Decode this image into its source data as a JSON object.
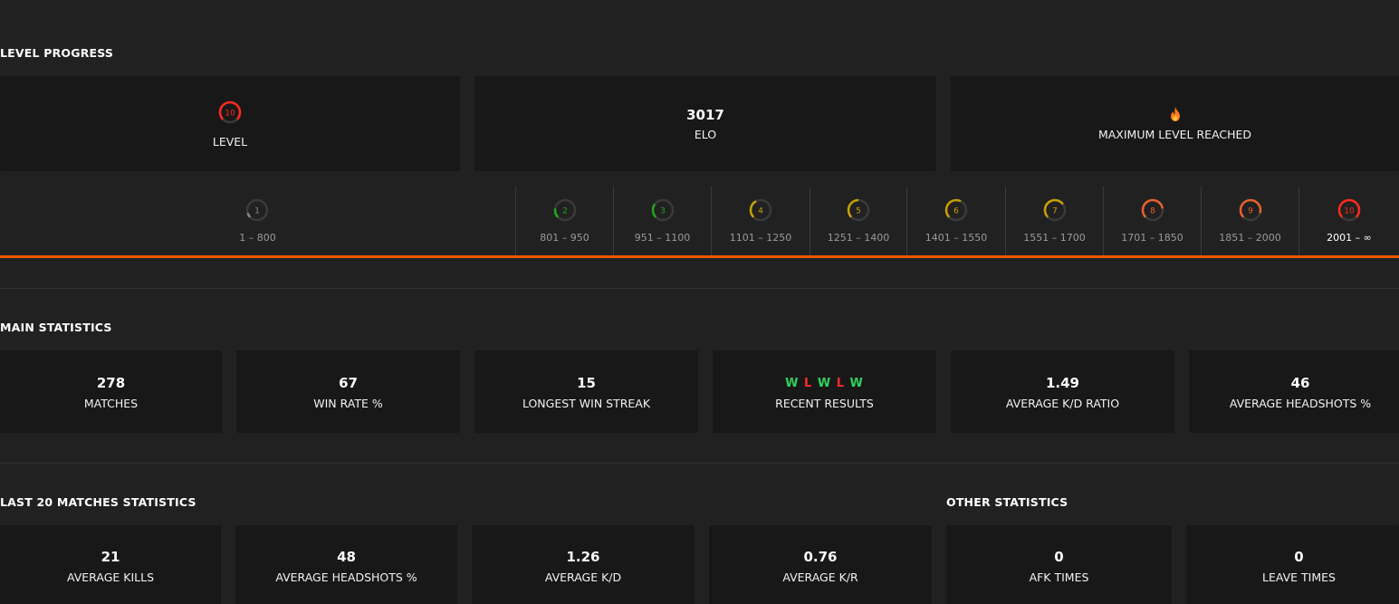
{
  "level_progress": {
    "title": "LEVEL PROGRESS",
    "level_card": {
      "level": "10",
      "label": "LEVEL"
    },
    "elo_card": {
      "value": "3017",
      "label": "ELO"
    },
    "max_card": {
      "icon": "fire-icon",
      "label": "MAXIMUM LEVEL REACHED"
    },
    "scale": [
      {
        "level": "1",
        "range": "1 – 800",
        "color": "#8a8a8a",
        "fill": 0.1
      },
      {
        "level": "2",
        "range": "801 – 950",
        "color": "#1ea81e",
        "fill": 0.2
      },
      {
        "level": "3",
        "range": "951 – 1100",
        "color": "#1ea81e",
        "fill": 0.3
      },
      {
        "level": "4",
        "range": "1101 – 1250",
        "color": "#c8a000",
        "fill": 0.4
      },
      {
        "level": "5",
        "range": "1251 – 1400",
        "color": "#c8a000",
        "fill": 0.5
      },
      {
        "level": "6",
        "range": "1401 – 1550",
        "color": "#c8a000",
        "fill": 0.6
      },
      {
        "level": "7",
        "range": "1551 – 1700",
        "color": "#c8a000",
        "fill": 0.7
      },
      {
        "level": "8",
        "range": "1701 – 1850",
        "color": "#e8612c",
        "fill": 0.8
      },
      {
        "level": "9",
        "range": "1851 – 2000",
        "color": "#e8612c",
        "fill": 0.9
      },
      {
        "level": "10",
        "range": "2001 – ∞",
        "color": "#ff2a1a",
        "fill": 1.0
      }
    ],
    "accent": "#ff5500"
  },
  "main_statistics": {
    "title": "MAIN STATISTICS",
    "cards": [
      {
        "value": "278",
        "label": "MATCHES"
      },
      {
        "value": "67",
        "label": "WIN RATE %"
      },
      {
        "value": "15",
        "label": "LONGEST WIN STREAK"
      },
      {
        "value": "",
        "label": "RECENT RESULTS"
      },
      {
        "value": "1.49",
        "label": "AVERAGE K/D RATIO"
      },
      {
        "value": "46",
        "label": "AVERAGE HEADSHOTS %"
      }
    ],
    "recent_results": [
      "W",
      "L",
      "W",
      "L",
      "W"
    ],
    "win_color": "#32d35a",
    "loss_color": "#ff2a2a"
  },
  "last20": {
    "title": "LAST 20 MATCHES STATISTICS",
    "cards": [
      {
        "value": "21",
        "label": "AVERAGE KILLS"
      },
      {
        "value": "48",
        "label": "AVERAGE HEADSHOTS %"
      },
      {
        "value": "1.26",
        "label": "AVERAGE K/D"
      },
      {
        "value": "0.76",
        "label": "AVERAGE K/R"
      }
    ]
  },
  "other": {
    "title": "OTHER STATISTICS",
    "cards": [
      {
        "value": "0",
        "label": "AFK TIMES"
      },
      {
        "value": "0",
        "label": "LEAVE TIMES"
      }
    ]
  }
}
